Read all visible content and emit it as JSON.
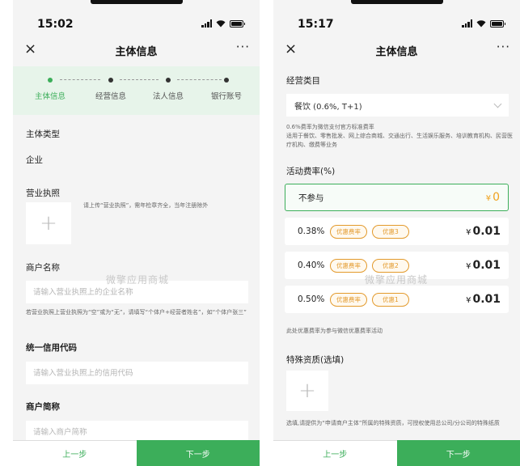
{
  "left": {
    "status": {
      "time": "15:02"
    },
    "nav": {
      "close": "×",
      "title": "主体信息",
      "more": "···"
    },
    "steps": [
      "主体信息",
      "经营信息",
      "法人信息",
      "银行账号"
    ],
    "subject_type": {
      "label": "主体类型",
      "value": "企业"
    },
    "license": {
      "label": "营业执照",
      "plus": "+",
      "hint": "请上传“营业执照”，需年检章齐全，当年注册除外"
    },
    "merchant_name": {
      "label": "商户名称",
      "placeholder": "请输入营业执照上的企业名称",
      "hint": "若营业执照上营业执照为“空”或为“无”，请填写“个体户+经营者姓名”，如“个体户张三”"
    },
    "credit_code": {
      "label": "统一信用代码",
      "placeholder": "请输入营业执照上的信用代码"
    },
    "short_name": {
      "label": "商户简称",
      "placeholder": "请输入商户简称"
    },
    "watermark": "微擎应用商城",
    "footer": {
      "prev": "上一步",
      "next": "下一步"
    }
  },
  "right": {
    "status": {
      "time": "15:17"
    },
    "nav": {
      "close": "×",
      "title": "主体信息",
      "more": "···"
    },
    "category": {
      "label": "经营类目",
      "value": "餐饮 (0.6%, T+1)",
      "hint": "0.6%费率为微信支付官方标准费率\n适用于餐饮、零售批发、网上综合商城、交通出行、生活娱乐服务、培训教育机构、民营医疗机构、缴费等业务"
    },
    "activity": {
      "label": "活动费率(%)",
      "options": [
        {
          "rate": "不参与",
          "tags": [],
          "currency": "¥",
          "amount": "0"
        },
        {
          "rate": "0.38%",
          "tags": [
            "优惠费率",
            "优惠3"
          ],
          "currency": "¥",
          "amount": "0.01"
        },
        {
          "rate": "0.40%",
          "tags": [
            "优惠费率",
            "优惠2"
          ],
          "currency": "¥",
          "amount": "0.01"
        },
        {
          "rate": "0.50%",
          "tags": [
            "优惠费率",
            "优惠1"
          ],
          "currency": "¥",
          "amount": "0.01"
        }
      ],
      "note": "此处优惠费率为参与微信优惠费率活动"
    },
    "special": {
      "label": "特殊资质(选填)",
      "plus": "+",
      "hint": "选填,请提供为“申请商户主体”所属的特殊资质，可授权使用总公司/分公司的特殊纸质"
    },
    "watermark": "微擎应用商城",
    "footer": {
      "prev": "上一步",
      "next": "下一步"
    }
  },
  "colors": {
    "accent": "#3cae5a",
    "step_bg": "#e7f4ea",
    "tag": "#e39a2c",
    "price_highlight": "#f0a21f"
  }
}
